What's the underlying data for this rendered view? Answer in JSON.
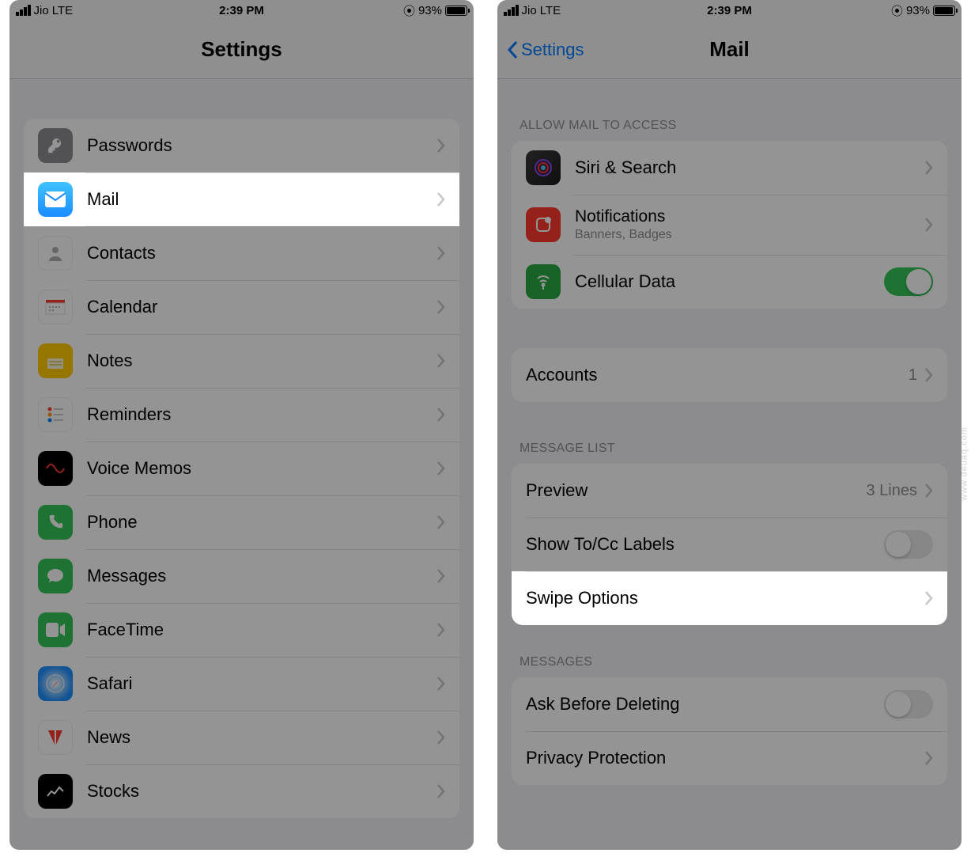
{
  "status": {
    "carrier": "Jio",
    "network": "LTE",
    "time": "2:39 PM",
    "battery_pct": "93%"
  },
  "left": {
    "title": "Settings",
    "items": [
      {
        "label": "Passwords",
        "icon": "key-icon"
      },
      {
        "label": "Mail",
        "icon": "mail-icon",
        "highlight": true
      },
      {
        "label": "Contacts",
        "icon": "contacts-icon"
      },
      {
        "label": "Calendar",
        "icon": "calendar-icon"
      },
      {
        "label": "Notes",
        "icon": "notes-icon"
      },
      {
        "label": "Reminders",
        "icon": "reminders-icon"
      },
      {
        "label": "Voice Memos",
        "icon": "voice-memos-icon"
      },
      {
        "label": "Phone",
        "icon": "phone-icon"
      },
      {
        "label": "Messages",
        "icon": "messages-icon"
      },
      {
        "label": "FaceTime",
        "icon": "facetime-icon"
      },
      {
        "label": "Safari",
        "icon": "safari-icon"
      },
      {
        "label": "News",
        "icon": "news-icon"
      },
      {
        "label": "Stocks",
        "icon": "stocks-icon"
      }
    ]
  },
  "right": {
    "back": "Settings",
    "title": "Mail",
    "section_access": "ALLOW MAIL TO ACCESS",
    "siri": "Siri & Search",
    "notifications": "Notifications",
    "notifications_sub": "Banners, Badges",
    "cellular": "Cellular Data",
    "accounts": "Accounts",
    "accounts_count": "1",
    "section_msglist": "MESSAGE LIST",
    "preview": "Preview",
    "preview_value": "3 Lines",
    "show_tocc": "Show To/Cc Labels",
    "swipe": "Swipe Options",
    "section_messages": "MESSAGES",
    "ask_delete": "Ask Before Deleting",
    "privacy": "Privacy Protection"
  },
  "watermark": "www.deuaq.com"
}
